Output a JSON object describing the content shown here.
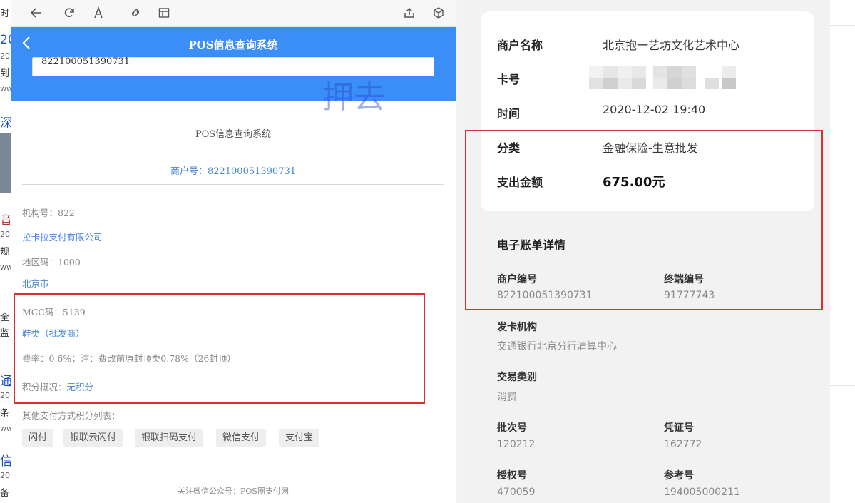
{
  "browser_toolbar": {
    "icons": [
      "back-arrow-icon",
      "refresh-icon",
      "text-size-icon",
      "link-icon",
      "reader-icon",
      "share-icon",
      "cube-icon"
    ]
  },
  "bg_fragments": [
    "时",
    "20",
    "20",
    "到",
    "ww",
    "深",
    "音",
    "20",
    "规",
    "ww",
    "全",
    "监",
    "通",
    "20",
    "条",
    "ww",
    "信",
    "20",
    "备"
  ],
  "app": {
    "title": "POS信息查询系统",
    "merchant_input_value": "822100051390731",
    "watermark": "押去"
  },
  "content": {
    "system_title": "POS信息查询系统",
    "merchant_no_line": "商户号：822100051390731",
    "org_no": "机构号：822",
    "org_name": "拉卡拉支付有限公司",
    "region_code": "地区码：1000",
    "city": "北京市",
    "mcc_code": "MCC码：5139",
    "category": "鞋类（批发商）",
    "fee_rate": "费率：0.6%；注：费改前原封顶类0.78%（26封顶）",
    "points_label": "积分概况：",
    "points_value": "无积分",
    "other_methods_label": "其他支付方式积分列表：",
    "payment_methods": [
      "闪付",
      "银联云闪付",
      "银联扫码支付",
      "微信支付",
      "支付宝"
    ],
    "footer": "关注微信公众号：POS圈支付网"
  },
  "bill": {
    "merchant_name_label": "商户名称",
    "merchant_name": "北京抱一艺坊文化艺术中心",
    "card_label": "卡号",
    "time_label": "时间",
    "time": "2020-12-02  19:40",
    "category_label": "分类",
    "category": "金融保险-生意批发",
    "amount_label": "支出金额",
    "amount": "675.00元"
  },
  "details": {
    "title": "电子账单详情",
    "merchant_code_label": "商户编号",
    "merchant_code": "822100051390731",
    "terminal_label": "终端编号",
    "terminal": "91777743",
    "issuer_label": "发卡机构",
    "issuer": "交通银行北京分行清算中心",
    "txn_type_label": "交易类别",
    "txn_type": "消费",
    "batch_label": "批次号",
    "batch": "120212",
    "voucher_label": "凭证号",
    "voucher": "162772",
    "auth_label": "授权号",
    "auth": "470059",
    "ref_label": "参考号",
    "ref": "194005000211"
  },
  "colors": {
    "header_blue": "#3b8ef5",
    "link_blue": "#4a86d8",
    "highlight_red": "#d93030"
  }
}
